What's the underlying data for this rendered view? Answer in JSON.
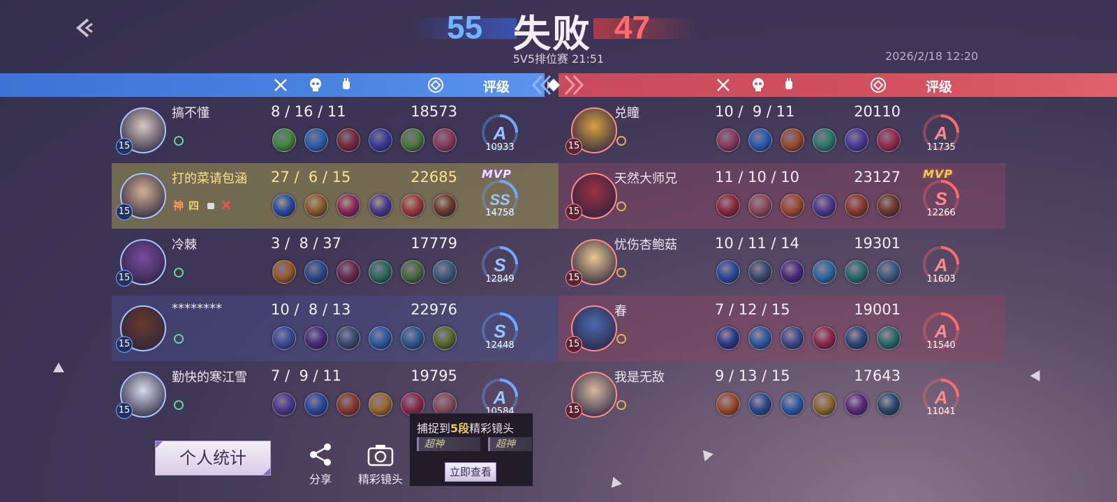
{
  "header": {
    "blue_score": "55",
    "result": "失败",
    "red_score": "47",
    "match_info": "5V5排位赛 21:51",
    "datetime": "2026/2/18 12:20",
    "rating_label": "评级"
  },
  "blue_team": [
    {
      "name": "搞不懂",
      "level": "15",
      "kda": "8 / 16 / 11",
      "damage": "18573",
      "rank": "A",
      "points": "10933",
      "mvp": "",
      "tags": [],
      "gold": false,
      "items": [
        "#3f8a3a",
        "#2b5fb0",
        "#7a2a3a",
        "#3a3a9a",
        "#4a7a3a",
        "#8a3a5a"
      ],
      "hero_color": "#d8c8c0"
    },
    {
      "name": "打的菜请包涵",
      "level": "15",
      "kda": "27 /  6 / 15",
      "damage": "22685",
      "rank": "SS",
      "points": "14758",
      "mvp": "MVP",
      "tags": [
        "神",
        "四"
      ],
      "gold": true,
      "items": [
        "#2b4aa0",
        "#8a5a2a",
        "#8a2a5a",
        "#4a3a8a",
        "#9a3a3a",
        "#6a3a2a"
      ],
      "hero_color": "#d4b090"
    },
    {
      "name": "冷棘",
      "level": "15",
      "kda": "3 /  8 / 37",
      "damage": "17779",
      "rank": "S",
      "points": "12849",
      "mvp": "",
      "tags": [],
      "gold": false,
      "items": [
        "#9a5a2a",
        "#2a4a8a",
        "#6a2a4a",
        "#2a6a5a",
        "#4a6a3a",
        "#3a5a7a"
      ],
      "hero_color": "#7a4aa0"
    },
    {
      "name": "********",
      "level": "15",
      "kda": "10 /  8 / 13",
      "damage": "22976",
      "rank": "S",
      "points": "12448",
      "mvp": "",
      "tags": [],
      "gold": false,
      "items": [
        "#3a4a9a",
        "#4a2a7a",
        "#3a4a6a",
        "#2a5aa0",
        "#2a5a8a",
        "#5a6a2a"
      ],
      "hero_color": "#6a3a2a"
    },
    {
      "name": "勤快的寒江雪",
      "level": "15",
      "kda": "7 /  9 / 11",
      "damage": "19795",
      "rank": "A",
      "points": "10584",
      "mvp": "",
      "tags": [],
      "gold": false,
      "items": [
        "#4a3a8a",
        "#2a4a9a",
        "#8a3a2a",
        "#9a6a2a",
        "#8a2a4a",
        "#8a4a5a"
      ],
      "hero_color": "#d8d8e8"
    }
  ],
  "red_team": [
    {
      "name": "兑瞳",
      "level": "15",
      "kda": "10 /  9 / 11",
      "damage": "20110",
      "rank": "A",
      "points": "11735",
      "mvp": "",
      "items": [
        "#8a3a5a",
        "#2a5ab0",
        "#9a4a2a",
        "#2a7a6a",
        "#4a3a9a",
        "#9a2a4a"
      ],
      "hero_color": "#d8a040"
    },
    {
      "name": "天然大师兄",
      "level": "15",
      "kda": "11 / 10 / 10",
      "damage": "23127",
      "rank": "S",
      "points": "12266",
      "mvp": "MVP",
      "items": [
        "#8a2a3a",
        "#8a4a5a",
        "#9a4a2a",
        "#4a3a8a",
        "#8a3a2a",
        "#6a3a2a"
      ],
      "hero_color": "#a03040"
    },
    {
      "name": "忧伤杏鲍菇",
      "level": "15",
      "kda": "10 / 11 / 14",
      "damage": "19301",
      "rank": "A",
      "points": "11603",
      "mvp": "",
      "items": [
        "#2a4a9a",
        "#3a4a6a",
        "#4a2a7a",
        "#2a6aa0",
        "#2a6a6a",
        "#3a5a7a"
      ],
      "hero_color": "#e8c890"
    },
    {
      "name": "春",
      "level": "15",
      "kda": "7 / 12 / 15",
      "damage": "19001",
      "rank": "A",
      "points": "11540",
      "mvp": "",
      "items": [
        "#2a3a8a",
        "#2a5aa0",
        "#3a4a8a",
        "#8a2a4a",
        "#2a4a7a",
        "#2a6a6a"
      ],
      "hero_color": "#4a6ab0"
    },
    {
      "name": "我是无敌",
      "level": "15",
      "kda": "9 / 13 / 15",
      "damage": "17643",
      "rank": "A",
      "points": "11041",
      "mvp": "",
      "items": [
        "#9a4a2a",
        "#2a4a8a",
        "#2a5aa0",
        "#8a6a2a",
        "#5a2a7a",
        "#2a4a6a"
      ],
      "hero_color": "#d8b8a0"
    }
  ],
  "bottom": {
    "stats_button": "个人统计",
    "share_label": "分享",
    "highlight_label": "精彩镜头"
  },
  "popup": {
    "title_prefix": "捕捉到",
    "title_count": "5段",
    "title_suffix": "精彩镜头",
    "clip1": "超神",
    "clip2": "超神",
    "button": "立即查看"
  },
  "colors": {
    "blue_bar": "#4a82e0",
    "red_bar": "#d2505f",
    "rank_blue": "#6fa8ff",
    "rank_red": "#ff6a6a",
    "mvp_gold": "#f3c660"
  }
}
